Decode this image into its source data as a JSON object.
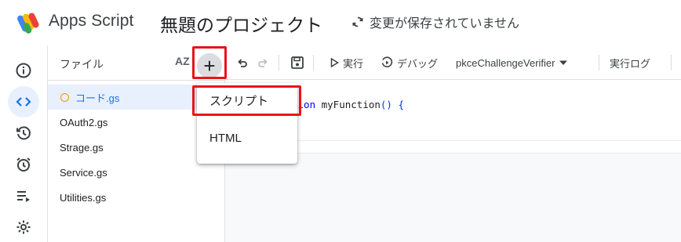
{
  "header": {
    "app_name": "Apps Script",
    "project_title": "無題のプロジェクト",
    "save_status": "変更が保存されていません"
  },
  "rail": {
    "items": [
      {
        "icon": "info-icon",
        "active": false
      },
      {
        "icon": "code-icon",
        "active": true
      },
      {
        "icon": "history-icon",
        "active": false
      },
      {
        "icon": "alarm-icon",
        "active": false
      },
      {
        "icon": "executions-icon",
        "active": false
      },
      {
        "icon": "gear-icon",
        "active": false
      }
    ]
  },
  "files": {
    "title": "ファイル",
    "sort_label": "AZ",
    "add_label": "+",
    "items": [
      "コード.gs",
      "OAuth2.gs",
      "Strage.gs",
      "Service.gs",
      "Utilities.gs"
    ]
  },
  "toolbar": {
    "run_label": "実行",
    "debug_label": "デバッグ",
    "function_select": "pkceChallengeVerifier",
    "log_label": "実行ログ"
  },
  "editor": {
    "code_keyword": "tion",
    "code_rest": " myFunction",
    "code_paren": "() {"
  },
  "add_menu": {
    "items": [
      "スクリプト",
      "HTML"
    ]
  },
  "colors": {
    "accent": "#1a73e8",
    "highlight_box": "#e8141a",
    "unsaved_dot": "#f29900"
  }
}
